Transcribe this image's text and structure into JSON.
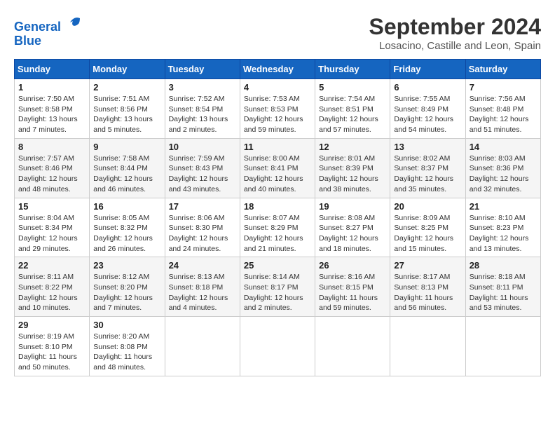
{
  "logo": {
    "line1": "General",
    "line2": "Blue"
  },
  "title": "September 2024",
  "location": "Losacino, Castille and Leon, Spain",
  "days_of_week": [
    "Sunday",
    "Monday",
    "Tuesday",
    "Wednesday",
    "Thursday",
    "Friday",
    "Saturday"
  ],
  "weeks": [
    [
      {
        "day": "1",
        "info": "Sunrise: 7:50 AM\nSunset: 8:58 PM\nDaylight: 13 hours\nand 7 minutes."
      },
      {
        "day": "2",
        "info": "Sunrise: 7:51 AM\nSunset: 8:56 PM\nDaylight: 13 hours\nand 5 minutes."
      },
      {
        "day": "3",
        "info": "Sunrise: 7:52 AM\nSunset: 8:54 PM\nDaylight: 13 hours\nand 2 minutes."
      },
      {
        "day": "4",
        "info": "Sunrise: 7:53 AM\nSunset: 8:53 PM\nDaylight: 12 hours\nand 59 minutes."
      },
      {
        "day": "5",
        "info": "Sunrise: 7:54 AM\nSunset: 8:51 PM\nDaylight: 12 hours\nand 57 minutes."
      },
      {
        "day": "6",
        "info": "Sunrise: 7:55 AM\nSunset: 8:49 PM\nDaylight: 12 hours\nand 54 minutes."
      },
      {
        "day": "7",
        "info": "Sunrise: 7:56 AM\nSunset: 8:48 PM\nDaylight: 12 hours\nand 51 minutes."
      }
    ],
    [
      {
        "day": "8",
        "info": "Sunrise: 7:57 AM\nSunset: 8:46 PM\nDaylight: 12 hours\nand 48 minutes."
      },
      {
        "day": "9",
        "info": "Sunrise: 7:58 AM\nSunset: 8:44 PM\nDaylight: 12 hours\nand 46 minutes."
      },
      {
        "day": "10",
        "info": "Sunrise: 7:59 AM\nSunset: 8:43 PM\nDaylight: 12 hours\nand 43 minutes."
      },
      {
        "day": "11",
        "info": "Sunrise: 8:00 AM\nSunset: 8:41 PM\nDaylight: 12 hours\nand 40 minutes."
      },
      {
        "day": "12",
        "info": "Sunrise: 8:01 AM\nSunset: 8:39 PM\nDaylight: 12 hours\nand 38 minutes."
      },
      {
        "day": "13",
        "info": "Sunrise: 8:02 AM\nSunset: 8:37 PM\nDaylight: 12 hours\nand 35 minutes."
      },
      {
        "day": "14",
        "info": "Sunrise: 8:03 AM\nSunset: 8:36 PM\nDaylight: 12 hours\nand 32 minutes."
      }
    ],
    [
      {
        "day": "15",
        "info": "Sunrise: 8:04 AM\nSunset: 8:34 PM\nDaylight: 12 hours\nand 29 minutes."
      },
      {
        "day": "16",
        "info": "Sunrise: 8:05 AM\nSunset: 8:32 PM\nDaylight: 12 hours\nand 26 minutes."
      },
      {
        "day": "17",
        "info": "Sunrise: 8:06 AM\nSunset: 8:30 PM\nDaylight: 12 hours\nand 24 minutes."
      },
      {
        "day": "18",
        "info": "Sunrise: 8:07 AM\nSunset: 8:29 PM\nDaylight: 12 hours\nand 21 minutes."
      },
      {
        "day": "19",
        "info": "Sunrise: 8:08 AM\nSunset: 8:27 PM\nDaylight: 12 hours\nand 18 minutes."
      },
      {
        "day": "20",
        "info": "Sunrise: 8:09 AM\nSunset: 8:25 PM\nDaylight: 12 hours\nand 15 minutes."
      },
      {
        "day": "21",
        "info": "Sunrise: 8:10 AM\nSunset: 8:23 PM\nDaylight: 12 hours\nand 13 minutes."
      }
    ],
    [
      {
        "day": "22",
        "info": "Sunrise: 8:11 AM\nSunset: 8:22 PM\nDaylight: 12 hours\nand 10 minutes."
      },
      {
        "day": "23",
        "info": "Sunrise: 8:12 AM\nSunset: 8:20 PM\nDaylight: 12 hours\nand 7 minutes."
      },
      {
        "day": "24",
        "info": "Sunrise: 8:13 AM\nSunset: 8:18 PM\nDaylight: 12 hours\nand 4 minutes."
      },
      {
        "day": "25",
        "info": "Sunrise: 8:14 AM\nSunset: 8:17 PM\nDaylight: 12 hours\nand 2 minutes."
      },
      {
        "day": "26",
        "info": "Sunrise: 8:16 AM\nSunset: 8:15 PM\nDaylight: 11 hours\nand 59 minutes."
      },
      {
        "day": "27",
        "info": "Sunrise: 8:17 AM\nSunset: 8:13 PM\nDaylight: 11 hours\nand 56 minutes."
      },
      {
        "day": "28",
        "info": "Sunrise: 8:18 AM\nSunset: 8:11 PM\nDaylight: 11 hours\nand 53 minutes."
      }
    ],
    [
      {
        "day": "29",
        "info": "Sunrise: 8:19 AM\nSunset: 8:10 PM\nDaylight: 11 hours\nand 50 minutes."
      },
      {
        "day": "30",
        "info": "Sunrise: 8:20 AM\nSunset: 8:08 PM\nDaylight: 11 hours\nand 48 minutes."
      },
      null,
      null,
      null,
      null,
      null
    ]
  ]
}
